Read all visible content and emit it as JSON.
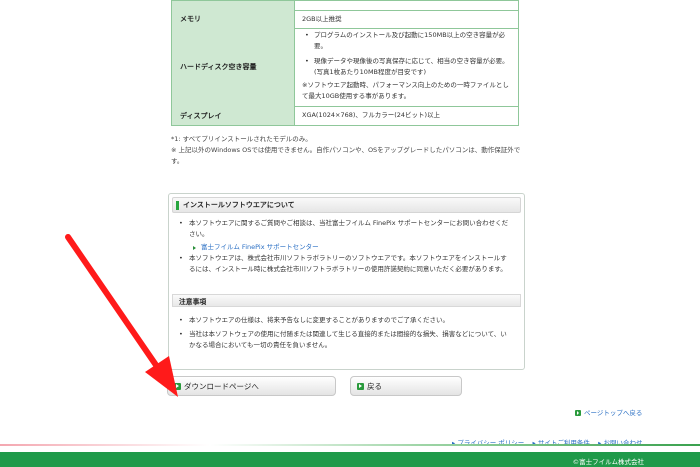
{
  "spec_table": {
    "rows": [
      {
        "label": "",
        "value": "2GB以上推奨"
      },
      {
        "label": "メモリ",
        "value": "2GB以上推奨"
      },
      {
        "label": "ハードディスク空き容量",
        "items": [
          "プログラムのインストール及び起動に150MB以上の空き容量が必要。",
          "現像データや現像後の写真保存に応じて、相当の空き容量が必要。(写真1枚あたり10MB程度が目安です)"
        ],
        "note": "※ソフトウエア起動時、パフォーマンス向上のための一時ファイルとして最大10GB使用する事があります。"
      },
      {
        "label": "ディスプレイ",
        "value": "XGA(1024×768)、フルカラー(24ビット)以上"
      }
    ]
  },
  "notes": {
    "line1": "*1: すべてプリインストールされたモデルのみ。",
    "line2": "※ 上記以外のWindows OSでは使用できません。自作パソコンや、OSをアップグレードしたパソコンは、動作保証外です。"
  },
  "install_panel": {
    "title": "インストールソフトウエアについて",
    "item1": "本ソフトウエアに関するご質問やご相談は、当社富士フイルム FinePix サポートセンターにお問い合わせください。",
    "support_link": "富士フイルム FinePix サポートセンター",
    "item2": "本ソフトウエアは、株式会社市川ソフトラボラトリーのソフトウエアです。本ソフトウエアをインストールするには、インストール時に株式会社市川ソフトラボラトリーの使用許諾契約に同意いただく必要があります。",
    "caution_title": "注意事項",
    "caution1": "本ソフトウエアの仕様は、将来予告なしに変更することがありますのでご了承ください。",
    "caution2": "当社は本ソフトウェアの使用に付随または関連して生じる直接的または間接的な損失、損害などについて、いかなる場合においても一切の責任を負いません。"
  },
  "buttons": {
    "download": "ダウンロードページへ",
    "back": "戻る"
  },
  "links": {
    "page_top": "ページトップへ戻る",
    "privacy": "プライバシー ポリシー",
    "terms": "サイトご利用条件",
    "contact": "お問い合わせ"
  },
  "footer": {
    "copyright": "©富士フイルム株式会社"
  },
  "colors": {
    "accent_green": "#27a53e",
    "footer_green": "#1f9a4a",
    "table_header": "#cfe8d2",
    "arrow_red": "#ff1a1a"
  }
}
